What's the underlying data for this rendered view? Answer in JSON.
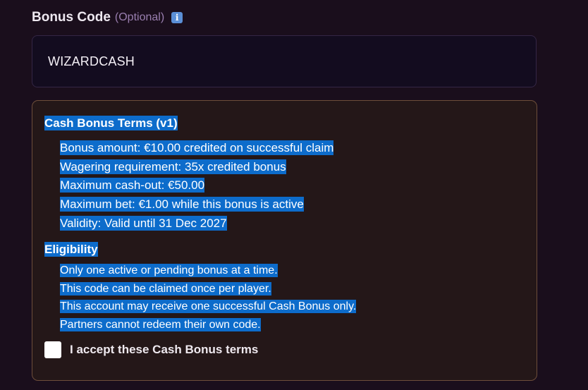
{
  "bonus_code": {
    "label": "Bonus Code",
    "optional": "(Optional)",
    "info_icon": "info-icon",
    "value": "WIZARDCASH"
  },
  "terms": {
    "title": "Cash Bonus Terms (v1)",
    "details": [
      "Bonus amount: €10.00 credited on successful claim",
      "Wagering requirement: 35x credited bonus",
      "Maximum cash-out: €50.00",
      "Maximum bet: €1.00 while this bonus is active",
      "Validity: Valid until 31 Dec 2027"
    ],
    "eligibility_title": "Eligibility",
    "eligibility": [
      "Only one active or pending bonus at a time.",
      "This code can be claimed once per player.",
      "This account may receive one successful Cash Bonus only.",
      "Partners cannot redeem their own code."
    ],
    "accept_label": "I accept these Cash Bonus terms",
    "accept_checked": false
  },
  "colors": {
    "selection": "#0d6ccb",
    "background": "#1a0e1c",
    "terms_border": "#6d4e3a"
  }
}
